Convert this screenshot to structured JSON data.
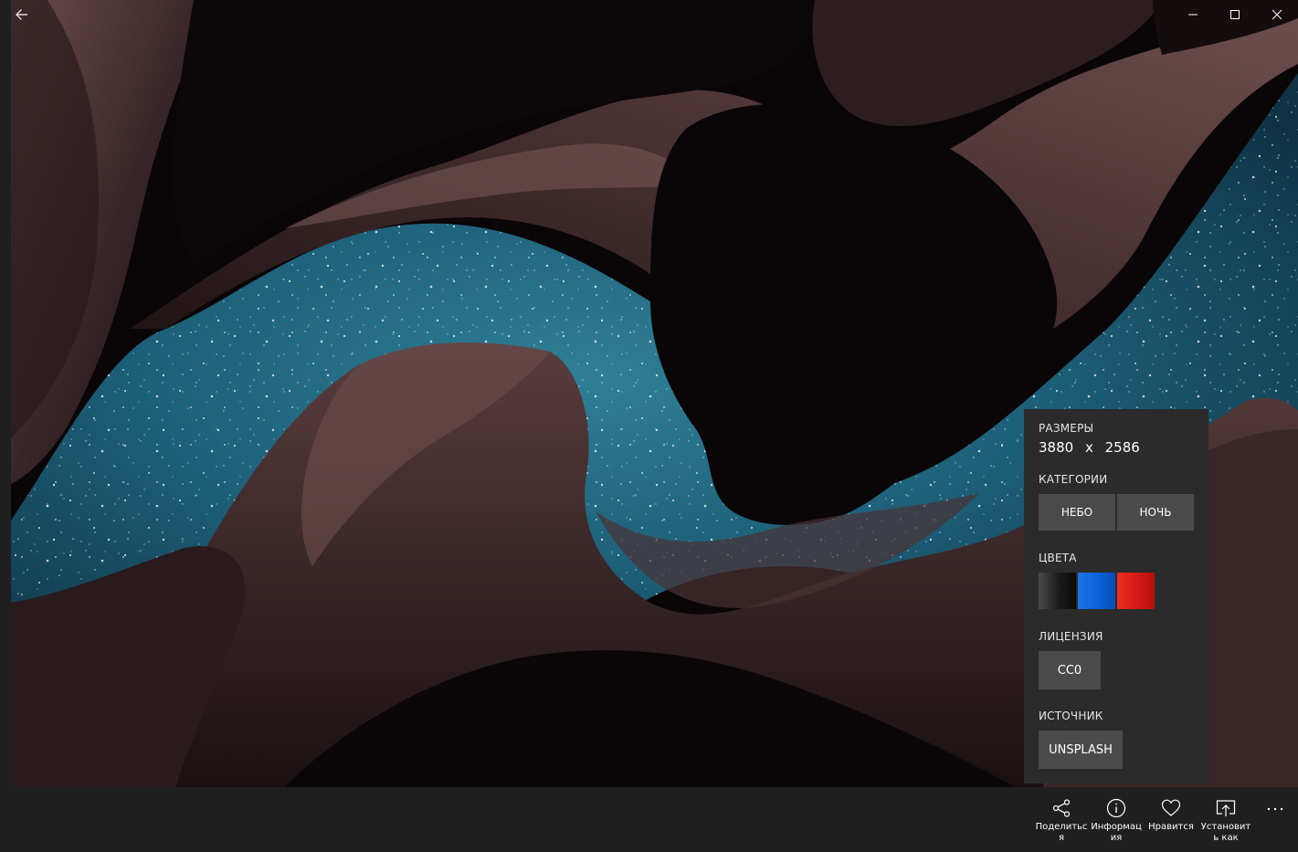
{
  "window": {
    "controls": {
      "back_icon": "arrow-left-icon",
      "minimize_icon": "minimize-icon",
      "maximize_icon": "maximize-icon",
      "close_icon": "close-icon"
    }
  },
  "info_panel": {
    "dimensions_label": "РАЗМЕРЫ",
    "width": "3880",
    "separator": "x",
    "height": "2586",
    "categories_label": "КАТЕГОРИИ",
    "categories": [
      "НЕБО",
      "НОЧЬ"
    ],
    "colors_label": "ЦВЕТА",
    "colors": [
      "#1b1b1b",
      "#0a5fd6",
      "#d11717"
    ],
    "license_label": "ЛИЦЕНЗИЯ",
    "license": "CC0",
    "source_label": "ИСТОЧНИК",
    "source": "UNSPLASH"
  },
  "command_bar": {
    "share_label": "Поделиться",
    "info_label": "Информация",
    "like_label": "Нравится",
    "set_as_label": "Установить как",
    "more_icon": "more-ellipsis-icon"
  }
}
